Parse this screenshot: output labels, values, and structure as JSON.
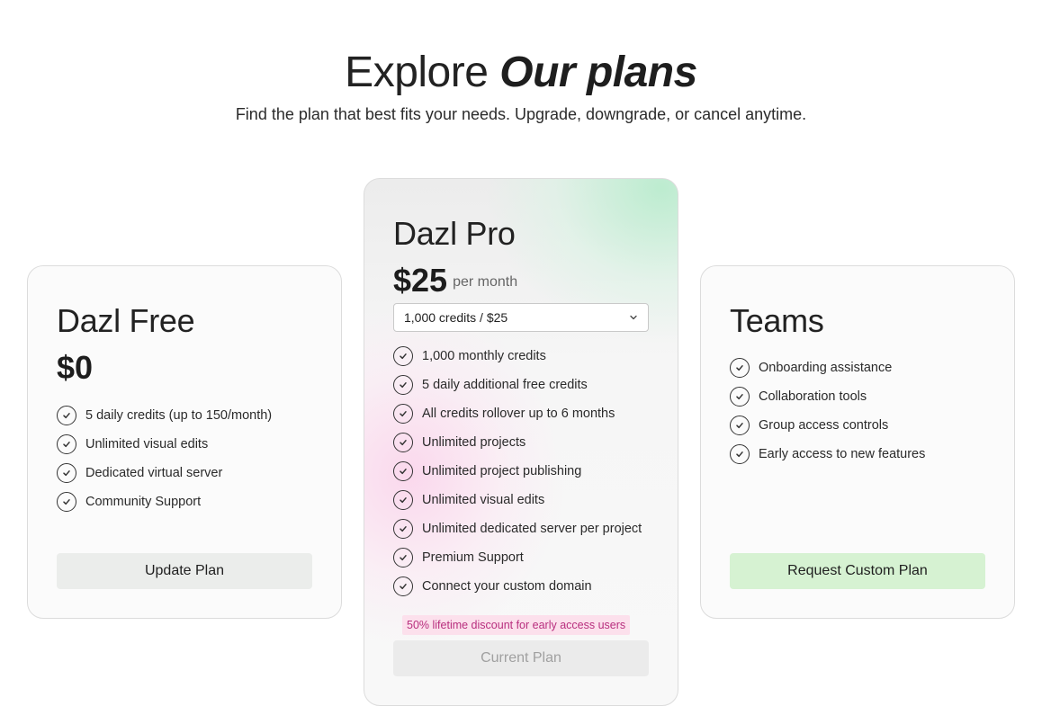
{
  "header": {
    "title_plain": "Explore",
    "title_emphasis": "Our plans",
    "subtitle": "Find the plan that best fits your needs. Upgrade, downgrade, or cancel anytime."
  },
  "plans": {
    "free": {
      "name": "Dazl Free",
      "price": "$0",
      "features": [
        "5 daily credits (up to 150/month)",
        "Unlimited visual edits",
        "Dedicated virtual server",
        "Community Support"
      ],
      "button_label": "Update Plan"
    },
    "pro": {
      "name": "Dazl Pro",
      "price": "$25",
      "period": "per month",
      "credits_select": "1,000 credits / $25",
      "features": [
        "1,000 monthly credits",
        "5 daily additional free credits",
        "All credits rollover up to 6 months",
        "Unlimited projects",
        "Unlimited project publishing",
        "Unlimited visual edits",
        "Unlimited dedicated server per project",
        "Premium Support",
        "Connect your custom domain"
      ],
      "discount_note": "50% lifetime discount for early access users",
      "button_label": "Current Plan"
    },
    "teams": {
      "name": "Teams",
      "features": [
        "Onboarding assistance",
        "Collaboration tools",
        "Group access controls",
        "Early access to new features"
      ],
      "button_label": "Request Custom Plan"
    }
  },
  "icons": {
    "feature": "check-circle-icon",
    "select": "chevron-down-icon"
  },
  "colors": {
    "teams_button": "#d6f2d2",
    "discount_bg": "#fce0ec",
    "discount_text": "#b82e7e"
  }
}
